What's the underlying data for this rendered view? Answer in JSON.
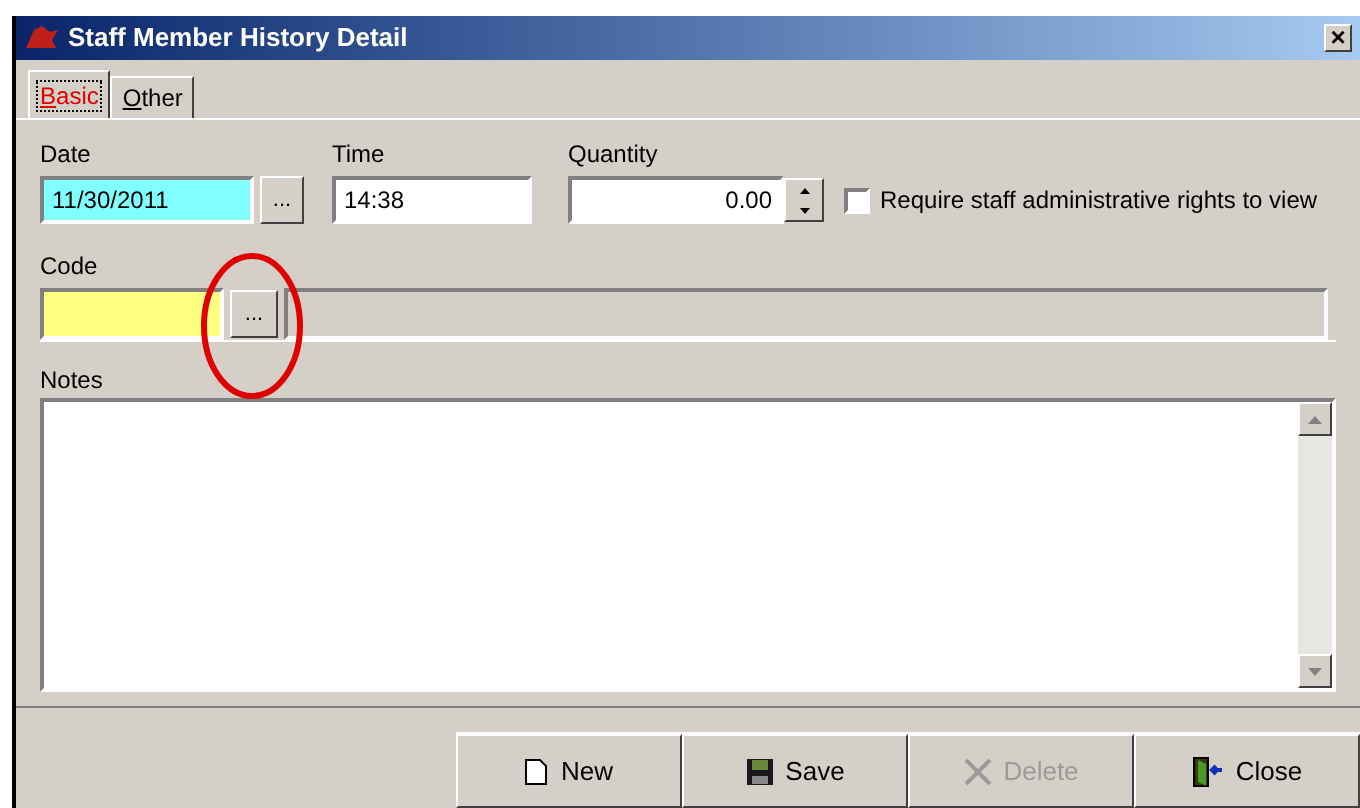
{
  "window": {
    "title": "Staff Member History Detail",
    "close": "×"
  },
  "tabs": [
    {
      "label": "Basic",
      "selected": true
    },
    {
      "label": "Other",
      "selected": false
    }
  ],
  "date": {
    "label": "Date",
    "value": "11/30/2011",
    "button": "..."
  },
  "time": {
    "label": "Time",
    "value": "14:38"
  },
  "quantity": {
    "label": "Quantity",
    "value": "0.00"
  },
  "require_rights": {
    "label": "Require staff administrative rights to view",
    "checked": false
  },
  "code": {
    "label": "Code",
    "button": "..."
  },
  "notes": {
    "label": "Notes"
  },
  "buttons": [
    {
      "label": "New",
      "kind": "new",
      "disabled": false
    },
    {
      "label": "Save",
      "kind": "save",
      "disabled": false
    },
    {
      "label": "Delete",
      "kind": "delete",
      "disabled": true
    },
    {
      "label": "Close",
      "kind": "close",
      "disabled": false
    }
  ]
}
